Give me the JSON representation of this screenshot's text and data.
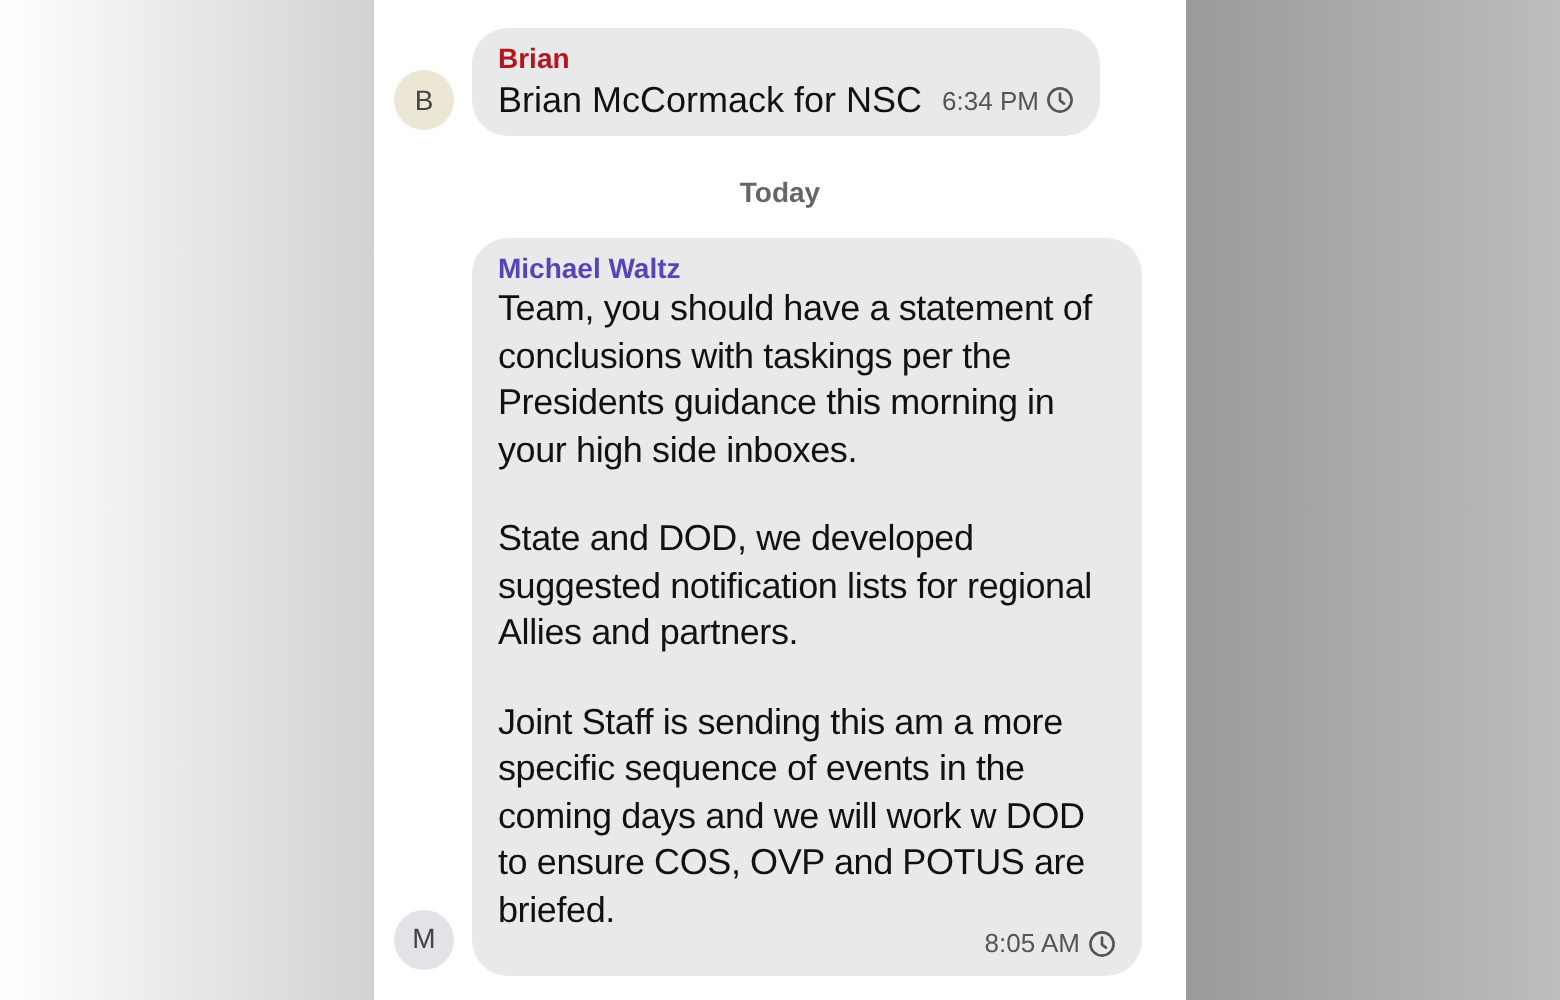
{
  "messages": [
    {
      "sender": "Brian",
      "color": "#b3171d",
      "avatar": {
        "letter": "B",
        "color": "#ece6d4"
      },
      "paragraphs": [
        "Brian McCormack for NSC"
      ],
      "time": "6:34 PM"
    },
    {
      "kind": "divider",
      "label": "Today"
    },
    {
      "sender": "Michael Waltz",
      "color": "#5346b8",
      "avatar": {
        "letter": "M",
        "color": "#e3e2e6"
      },
      "paragraphs": [
        "Team, you should have a statement of conclusions with taskings per the Presidents guidance this morning in your high side inboxes.",
        "State and DOD, we developed suggested notification lists for regional Allies and partners.",
        "Joint Staff is sending this am a more specific sequence of events in the coming days and we will work w DOD to ensure COS, OVP and POTUS are briefed."
      ],
      "time": "8:05 AM"
    }
  ]
}
